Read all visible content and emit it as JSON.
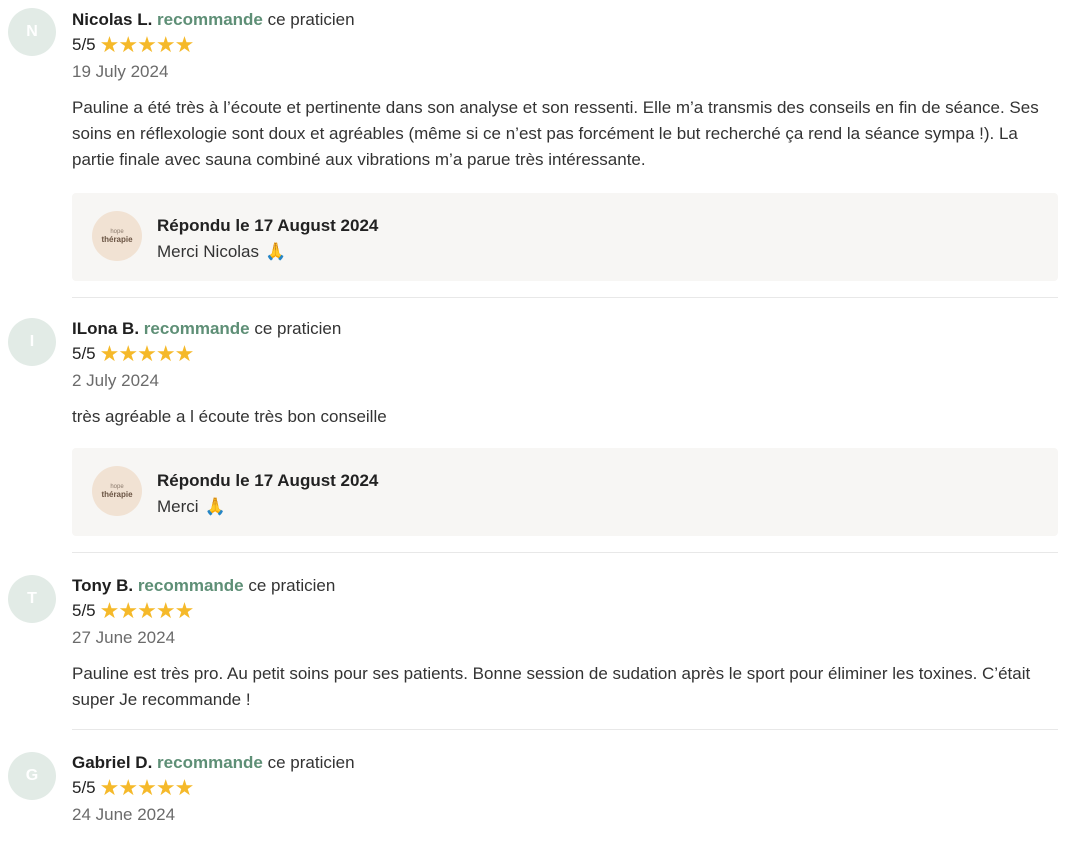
{
  "reviews": [
    {
      "initial": "N",
      "name": "Nicolas L.",
      "recommend": "recommande",
      "practitioner": "ce praticien",
      "rating": "5/5",
      "stars": 5,
      "date": "19 July 2024",
      "text": "Pauline a été très à l’écoute et pertinente dans son analyse et son ressenti. Elle m’a transmis des conseils en fin de séance. Ses soins en réflexologie sont doux et agréables (même si ce n’est pas forcément le but recherché ça rend la séance sympa !). La partie finale avec sauna combiné aux vibrations m’a parue très intéressante.",
      "reply": {
        "logo_small": "hope",
        "logo_main": "thérapie",
        "title": "Répondu le 17 August 2024",
        "text": "Merci Nicolas",
        "emoji": "🙏"
      }
    },
    {
      "initial": "I",
      "name": "ILona B.",
      "recommend": "recommande",
      "practitioner": "ce praticien",
      "rating": "5/5",
      "stars": 5,
      "date": "2 July 2024",
      "text": "très agréable a l écoute très bon conseille",
      "reply": {
        "logo_small": "hope",
        "logo_main": "thérapie",
        "title": "Répondu le 17 August 2024",
        "text": "Merci",
        "emoji": "🙏"
      }
    },
    {
      "initial": "T",
      "name": "Tony B.",
      "recommend": "recommande",
      "practitioner": "ce praticien",
      "rating": "5/5",
      "stars": 5,
      "date": "27 June 2024",
      "text": "Pauline est très pro. Au petit soins pour ses patients. Bonne session de sudation après le sport pour éliminer les toxines. C’était super Je recommande !"
    },
    {
      "initial": "G",
      "name": "Gabriel D.",
      "recommend": "recommande",
      "practitioner": "ce praticien",
      "rating": "5/5",
      "stars": 5,
      "date": "24 June 2024"
    }
  ],
  "colors": {
    "recommend": "#5e8f76",
    "star": "#f5b92a",
    "avatar_bg": "#e2ebe6",
    "reply_bg": "#f7f6f4"
  }
}
